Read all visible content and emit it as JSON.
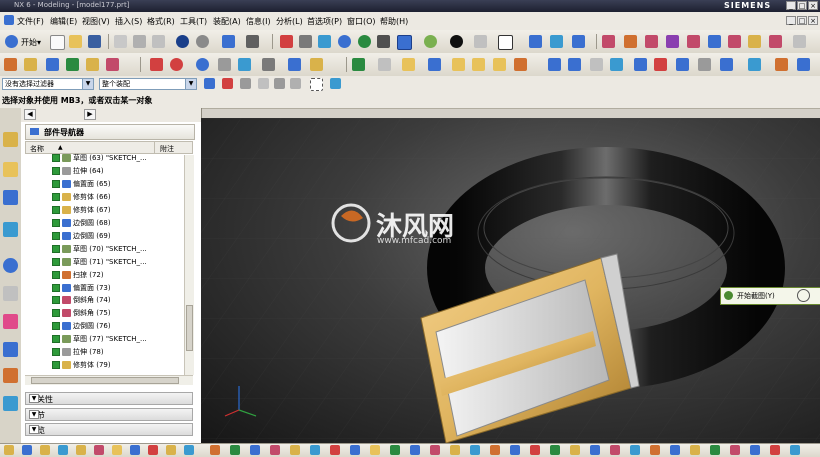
{
  "window": {
    "title": "NX 6 - Modeling - [model177.prt]",
    "brand": "SIEMENS",
    "controls": [
      "_",
      "□",
      "×"
    ]
  },
  "menubar": {
    "start_label": "开始▾",
    "items": [
      "文件(F)",
      "编辑(E)",
      "视图(V)",
      "插入(S)",
      "格式(R)",
      "工具(T)",
      "装配(A)",
      "信息(I)",
      "分析(L)",
      "首选项(P)",
      "窗口(O)",
      "帮助(H)"
    ]
  },
  "filterbar": {
    "type_filter": "没有选择过滤器",
    "scope": "整个装配"
  },
  "status": {
    "prompt": "选择对象并使用 MB3，或者双击某一对象"
  },
  "navigator": {
    "title": "部件导航器",
    "columns": {
      "name": "名称",
      "sort_indicator": "▲",
      "comment": "附注"
    },
    "rows": [
      {
        "label": "草图 (63) \"SKETCH_...",
        "icon": "sketch-icon",
        "color": "#7a9a5a"
      },
      {
        "label": "拉伸 (64)",
        "icon": "extrude-icon",
        "color": "#9a9a9a"
      },
      {
        "label": "偏置面 (65)",
        "icon": "offset-face-icon",
        "color": "#3a6fd0"
      },
      {
        "label": "修剪体 (66)",
        "icon": "trim-body-icon",
        "color": "#d9b24a"
      },
      {
        "label": "修剪体 (67)",
        "icon": "trim-body-icon",
        "color": "#d9b24a"
      },
      {
        "label": "边倒圆 (68)",
        "icon": "edge-blend-icon",
        "color": "#3a6fd0"
      },
      {
        "label": "边倒圆 (69)",
        "icon": "edge-blend-icon",
        "color": "#3a6fd0"
      },
      {
        "label": "草图 (70) \"SKETCH_...",
        "icon": "sketch-icon",
        "color": "#7a9a5a"
      },
      {
        "label": "草图 (71) \"SKETCH_...",
        "icon": "sketch-icon",
        "color": "#7a9a5a"
      },
      {
        "label": "扫掠 (72)",
        "icon": "sweep-icon",
        "color": "#d07030"
      },
      {
        "label": "偏置面 (73)",
        "icon": "offset-face-icon",
        "color": "#3a6fd0"
      },
      {
        "label": "倒斜角 (74)",
        "icon": "chamfer-icon",
        "color": "#c24a6a"
      },
      {
        "label": "倒斜角 (75)",
        "icon": "chamfer-icon",
        "color": "#c24a6a"
      },
      {
        "label": "边倒圆 (76)",
        "icon": "edge-blend-icon",
        "color": "#3a6fd0"
      },
      {
        "label": "草图 (77) \"SKETCH_...",
        "icon": "sketch-icon",
        "color": "#7a9a5a"
      },
      {
        "label": "拉伸 (78)",
        "icon": "extrude-icon",
        "color": "#9a9a9a"
      },
      {
        "label": "修剪体 (79)",
        "icon": "trim-body-icon",
        "color": "#d9b24a"
      }
    ],
    "sections": [
      "相关性",
      "细节",
      "预览"
    ]
  },
  "viewport": {
    "watermark_main": "沐风网",
    "watermark_url": "www.mfcad.com",
    "tooltip": "开始截图(Y)"
  },
  "colors": {
    "accent": "#3a6fd0",
    "check": "#2e9a3a",
    "buckle_gold": "#e0b560"
  }
}
